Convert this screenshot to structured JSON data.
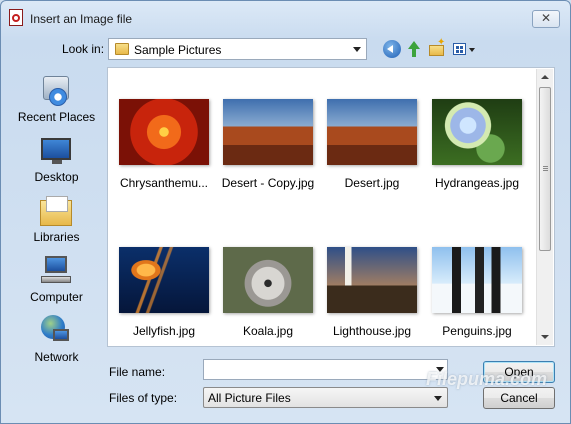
{
  "window": {
    "title": "Insert an Image file",
    "close_glyph": "✕"
  },
  "toolbar": {
    "look_in_label": "Look in:",
    "look_in_value": "Sample Pictures",
    "icons": [
      "back-icon",
      "up-folder-icon",
      "new-folder-icon",
      "views-menu-icon"
    ]
  },
  "places": [
    {
      "label": "Recent Places",
      "icon": "recent-places-icon"
    },
    {
      "label": "Desktop",
      "icon": "desktop-icon"
    },
    {
      "label": "Libraries",
      "icon": "libraries-icon"
    },
    {
      "label": "Computer",
      "icon": "computer-icon"
    },
    {
      "label": "Network",
      "icon": "network-icon"
    }
  ],
  "files": [
    {
      "name": "Chrysanthemu...",
      "thumb": "chrysanthemum"
    },
    {
      "name": "Desert - Copy.jpg",
      "thumb": "desert"
    },
    {
      "name": "Desert.jpg",
      "thumb": "desert"
    },
    {
      "name": "Hydrangeas.jpg",
      "thumb": "hydrangeas"
    },
    {
      "name": "Jellyfish.jpg",
      "thumb": "jellyfish"
    },
    {
      "name": "Koala.jpg",
      "thumb": "koala"
    },
    {
      "name": "Lighthouse.jpg",
      "thumb": "lighthouse"
    },
    {
      "name": "Penguins.jpg",
      "thumb": "penguins"
    }
  ],
  "form": {
    "file_name_label": "File name:",
    "file_name_value": "",
    "file_type_label": "Files of type:",
    "file_type_value": "All Picture Files"
  },
  "buttons": {
    "open": "Open",
    "cancel": "Cancel"
  },
  "watermark": "Filepuma.com"
}
